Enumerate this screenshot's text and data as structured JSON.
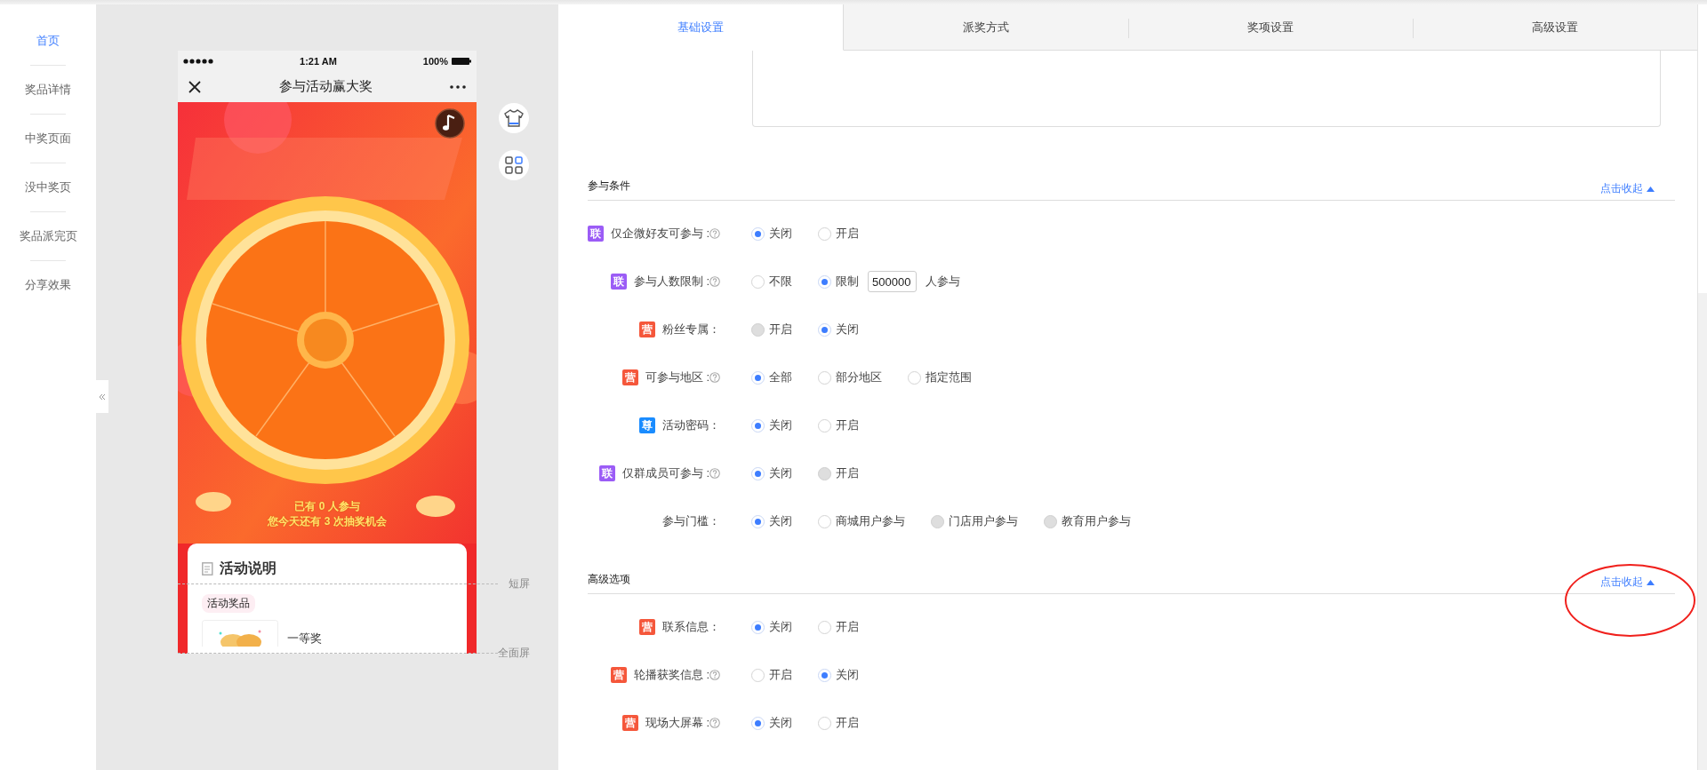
{
  "nav": {
    "items": [
      {
        "label": "首页",
        "selected": true
      },
      {
        "label": "奖品详情",
        "selected": false
      },
      {
        "label": "中奖页面",
        "selected": false
      },
      {
        "label": "没中奖页",
        "selected": false
      },
      {
        "label": "奖品派完页",
        "selected": false
      },
      {
        "label": "分享效果",
        "selected": false
      }
    ]
  },
  "phone": {
    "status": {
      "time": "1:21 AM",
      "battery": "100%"
    },
    "title": "参与活动赢大奖",
    "banner": {
      "kind": "picture",
      "participants": "已有 0 人参与",
      "chances": "您今天还有 3 次抽奖机会"
    },
    "card": {
      "title": "活动说明",
      "tag": "活动奖品",
      "prize": "一等奖"
    },
    "markers": [
      {
        "label": "短屏"
      },
      {
        "label": "全面屏"
      }
    ]
  },
  "tabs": [
    {
      "label": "基础设置",
      "selected": true
    },
    {
      "label": "派奖方式",
      "selected": false
    },
    {
      "label": "奖项设置",
      "selected": false
    },
    {
      "label": "高级设置",
      "selected": false
    }
  ],
  "sections": [
    {
      "title": "参与条件",
      "toggle": "点击收起",
      "annotated": false,
      "rows": [
        {
          "badge": {
            "text": "联",
            "color": "#9b5cf6"
          },
          "label": "仅企微好友可参与 :",
          "help": true,
          "options": [
            {
              "label": "关闭",
              "selected": true,
              "disabled": false
            },
            {
              "label": "开启",
              "selected": false,
              "disabled": false
            }
          ]
        },
        {
          "badge": {
            "text": "联",
            "color": "#9b5cf6"
          },
          "label": "参与人数限制 :",
          "help": true,
          "options": [
            {
              "label": "不限",
              "selected": false,
              "disabled": false
            },
            {
              "label": "限制",
              "selected": true,
              "disabled": false
            }
          ],
          "input": {
            "value": "500000"
          },
          "suffix": "人参与"
        },
        {
          "badge": {
            "text": "营",
            "color": "#f5573b"
          },
          "label": "粉丝专属：",
          "help": false,
          "options": [
            {
              "label": "开启",
              "selected": false,
              "disabled": true
            },
            {
              "label": "关闭",
              "selected": true,
              "disabled": false
            }
          ]
        },
        {
          "badge": {
            "text": "营",
            "color": "#f5573b"
          },
          "label": "可参与地区 :",
          "help": true,
          "options": [
            {
              "label": "全部",
              "selected": true,
              "disabled": false
            },
            {
              "label": "部分地区",
              "selected": false,
              "disabled": false
            },
            {
              "label": "指定范围",
              "selected": false,
              "disabled": false
            }
          ]
        },
        {
          "badge": {
            "text": "尊",
            "color": "#1a8cff"
          },
          "label": "活动密码：",
          "help": false,
          "options": [
            {
              "label": "关闭",
              "selected": true,
              "disabled": false
            },
            {
              "label": "开启",
              "selected": false,
              "disabled": false
            }
          ]
        },
        {
          "badge": {
            "text": "联",
            "color": "#9b5cf6"
          },
          "label": "仅群成员可参与 :",
          "help": true,
          "options": [
            {
              "label": "关闭",
              "selected": true,
              "disabled": false
            },
            {
              "label": "开启",
              "selected": false,
              "disabled": true
            }
          ]
        },
        {
          "label": "参与门槛：",
          "help": false,
          "options": [
            {
              "label": "关闭",
              "selected": true,
              "disabled": false
            },
            {
              "label": "商城用户参与",
              "selected": false,
              "disabled": false
            },
            {
              "label": "门店用户参与",
              "selected": false,
              "disabled": true
            },
            {
              "label": "教育用户参与",
              "selected": false,
              "disabled": true
            }
          ]
        }
      ]
    },
    {
      "title": "高级选项",
      "toggle": "点击收起",
      "annotated": true,
      "rows": [
        {
          "badge": {
            "text": "营",
            "color": "#f5573b"
          },
          "label": "联系信息：",
          "help": false,
          "options": [
            {
              "label": "关闭",
              "selected": true,
              "disabled": false
            },
            {
              "label": "开启",
              "selected": false,
              "disabled": false
            }
          ]
        },
        {
          "badge": {
            "text": "营",
            "color": "#f5573b"
          },
          "label": "轮播获奖信息 :",
          "help": true,
          "options": [
            {
              "label": "开启",
              "selected": false,
              "disabled": false
            },
            {
              "label": "关闭",
              "selected": true,
              "disabled": false
            }
          ]
        },
        {
          "badge": {
            "text": "营",
            "color": "#f5573b"
          },
          "label": "现场大屏幕 :",
          "help": true,
          "options": [
            {
              "label": "关闭",
              "selected": true,
              "disabled": false
            },
            {
              "label": "开启",
              "selected": false,
              "disabled": false
            }
          ]
        }
      ]
    }
  ]
}
